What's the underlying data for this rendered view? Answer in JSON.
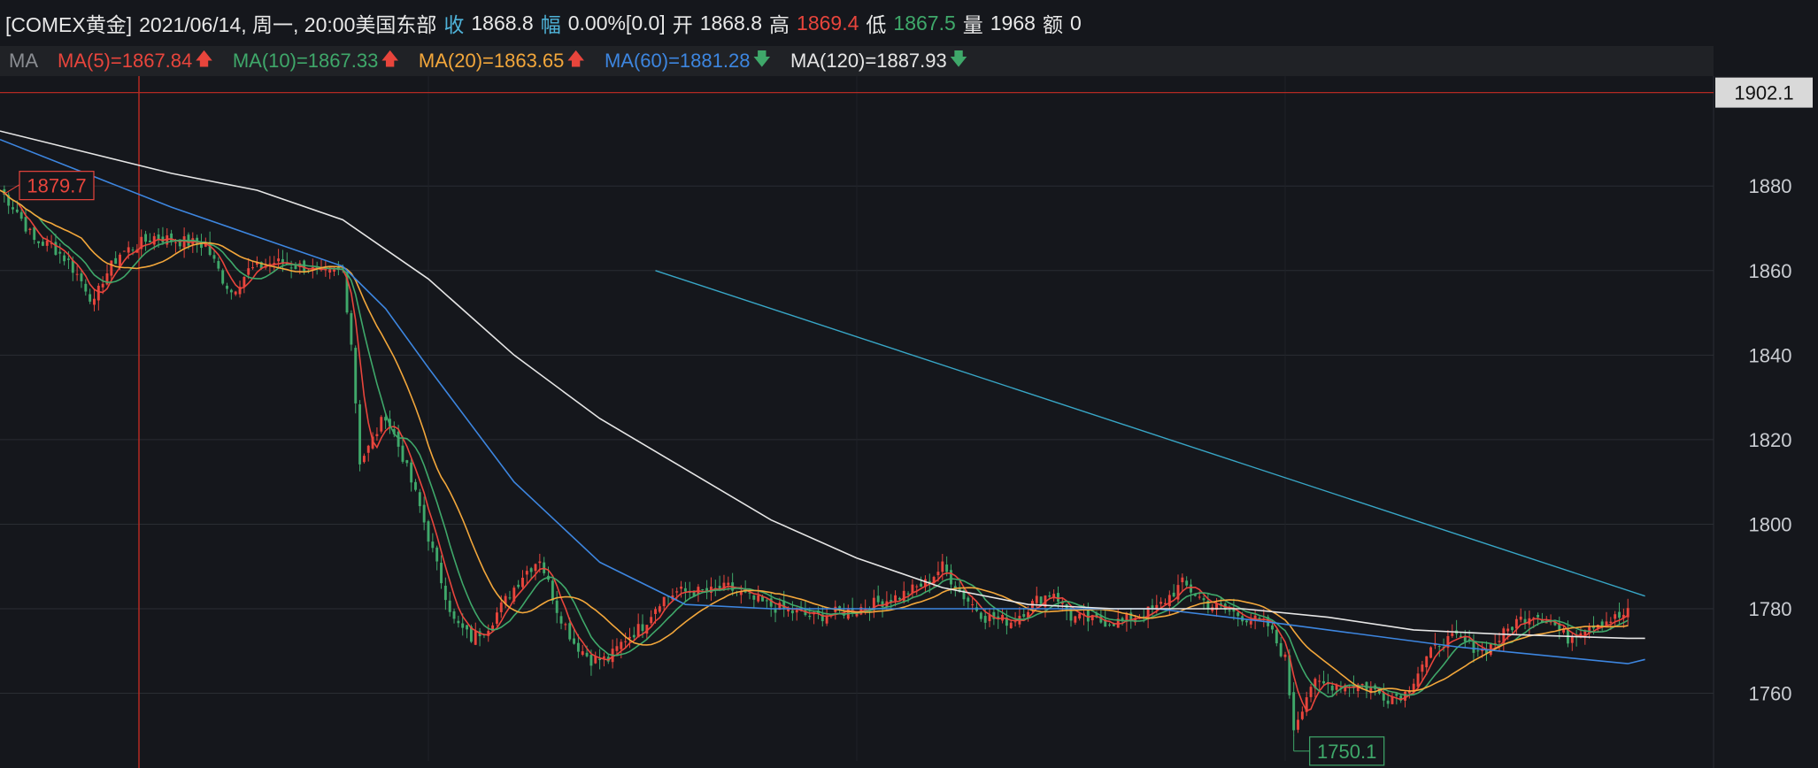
{
  "header": {
    "instrument": "[COMEX黄金]",
    "datetime": "2021/06/14, 周一, 20:00美国东部",
    "close_label": "收",
    "close_value": "1868.8",
    "change_label": "幅",
    "change_value": "0.00%[0.0]",
    "open_label": "开",
    "open_value": "1868.8",
    "high_label": "高",
    "high_value": "1869.4",
    "low_label": "低",
    "low_value": "1867.5",
    "volume_label": "量",
    "volume_value": "1968",
    "amount_label": "额",
    "amount_value": "0"
  },
  "ma_bar": {
    "label": "MA",
    "items": [
      {
        "text": "MA(5)=1867.84",
        "trend": "up",
        "color": "#e8453c"
      },
      {
        "text": "MA(10)=1867.33",
        "trend": "up",
        "color": "#3fa86a"
      },
      {
        "text": "MA(20)=1863.65",
        "trend": "up",
        "color": "#f3a73b"
      },
      {
        "text": "MA(60)=1881.28",
        "trend": "down",
        "color": "#3d86e0"
      },
      {
        "text": "MA(120)=1887.93",
        "trend": "down",
        "color": "#e6e6e6"
      }
    ]
  },
  "colors": {
    "background": "#15171c",
    "grid": "#2a2d33",
    "up": "#e8453c",
    "down": "#3fa86a",
    "cursor": "#b32a22",
    "trend_line": "#38a6c6"
  },
  "chart_data": {
    "type": "candlestick",
    "y_ticks": [
      "1880",
      "1860",
      "1840",
      "1820",
      "1800",
      "1780",
      "1760"
    ],
    "ylim": [
      1744,
      1906
    ],
    "grid": true,
    "price_tag": "1902.1",
    "max_label": "1879.7",
    "min_label": "1750.1",
    "x_range": [
      0,
      400
    ],
    "closes": [
      [
        0,
        1879
      ],
      [
        4,
        1874
      ],
      [
        8,
        1867
      ],
      [
        12,
        1866
      ],
      [
        16,
        1862
      ],
      [
        20,
        1856
      ],
      [
        22,
        1852
      ],
      [
        24,
        1858
      ],
      [
        28,
        1864
      ],
      [
        32,
        1866
      ],
      [
        36,
        1868
      ],
      [
        42,
        1867
      ],
      [
        48,
        1866
      ],
      [
        52,
        1858
      ],
      [
        54,
        1855
      ],
      [
        58,
        1860
      ],
      [
        64,
        1862
      ],
      [
        70,
        1861
      ],
      [
        76,
        1859
      ],
      [
        80,
        1860
      ],
      [
        82,
        1843
      ],
      [
        84,
        1815
      ],
      [
        86,
        1818
      ],
      [
        90,
        1826
      ],
      [
        94,
        1816
      ],
      [
        98,
        1804
      ],
      [
        102,
        1790
      ],
      [
        106,
        1777
      ],
      [
        110,
        1773
      ],
      [
        114,
        1776
      ],
      [
        118,
        1782
      ],
      [
        122,
        1788
      ],
      [
        126,
        1792
      ],
      [
        130,
        1780
      ],
      [
        134,
        1772
      ],
      [
        138,
        1768
      ],
      [
        142,
        1768
      ],
      [
        146,
        1773
      ],
      [
        150,
        1776
      ],
      [
        154,
        1782
      ],
      [
        158,
        1784
      ],
      [
        162,
        1784
      ],
      [
        166,
        1784
      ],
      [
        170,
        1785
      ],
      [
        176,
        1782
      ],
      [
        182,
        1780
      ],
      [
        190,
        1778
      ],
      [
        200,
        1780
      ],
      [
        210,
        1783
      ],
      [
        216,
        1786
      ],
      [
        220,
        1790
      ],
      [
        224,
        1784
      ],
      [
        230,
        1778
      ],
      [
        236,
        1777
      ],
      [
        242,
        1782
      ],
      [
        246,
        1784
      ],
      [
        250,
        1778
      ],
      [
        256,
        1777
      ],
      [
        262,
        1777
      ],
      [
        270,
        1780
      ],
      [
        276,
        1786
      ],
      [
        282,
        1781
      ],
      [
        288,
        1779
      ],
      [
        296,
        1776
      ],
      [
        300,
        1768
      ],
      [
        302,
        1752
      ],
      [
        306,
        1762
      ],
      [
        312,
        1762
      ],
      [
        318,
        1762
      ],
      [
        324,
        1759
      ],
      [
        328,
        1760
      ],
      [
        332,
        1767
      ],
      [
        336,
        1772
      ],
      [
        340,
        1773
      ],
      [
        346,
        1770
      ],
      [
        350,
        1773
      ],
      [
        354,
        1777
      ],
      [
        358,
        1779
      ],
      [
        362,
        1777
      ],
      [
        366,
        1773
      ],
      [
        370,
        1776
      ],
      [
        374,
        1777
      ],
      [
        378,
        1778
      ],
      [
        380,
        1779
      ]
    ],
    "series": [
      {
        "name": "MA(5)",
        "color": "#e8453c",
        "values": []
      },
      {
        "name": "MA(10)",
        "color": "#3fa86a",
        "values": []
      },
      {
        "name": "MA(20)",
        "color": "#f3a73b",
        "values": []
      },
      {
        "name": "MA(60)",
        "color": "#3d86e0",
        "values": [
          [
            0,
            1891
          ],
          [
            20,
            1883
          ],
          [
            40,
            1875
          ],
          [
            60,
            1868
          ],
          [
            80,
            1861
          ],
          [
            90,
            1851
          ],
          [
            100,
            1837
          ],
          [
            120,
            1810
          ],
          [
            140,
            1791
          ],
          [
            160,
            1781
          ],
          [
            180,
            1780
          ],
          [
            200,
            1780
          ],
          [
            230,
            1780
          ],
          [
            270,
            1780
          ],
          [
            295,
            1777
          ],
          [
            310,
            1775
          ],
          [
            340,
            1771
          ],
          [
            380,
            1767
          ],
          [
            384,
            1768
          ]
        ]
      },
      {
        "name": "MA(120)",
        "color": "#e6e6e6",
        "values": [
          [
            0,
            1893
          ],
          [
            20,
            1888
          ],
          [
            40,
            1883
          ],
          [
            60,
            1879
          ],
          [
            80,
            1872
          ],
          [
            100,
            1858
          ],
          [
            120,
            1840
          ],
          [
            140,
            1825
          ],
          [
            160,
            1813
          ],
          [
            180,
            1801
          ],
          [
            200,
            1792
          ],
          [
            220,
            1785
          ],
          [
            240,
            1781
          ],
          [
            260,
            1780
          ],
          [
            290,
            1780
          ],
          [
            310,
            1778
          ],
          [
            330,
            1775
          ],
          [
            350,
            1774
          ],
          [
            380,
            1773
          ],
          [
            384,
            1773
          ]
        ]
      },
      {
        "name": "trend",
        "color": "#38a6c6",
        "values": [
          [
            153,
            1860
          ],
          [
            384,
            1783
          ]
        ]
      }
    ]
  }
}
